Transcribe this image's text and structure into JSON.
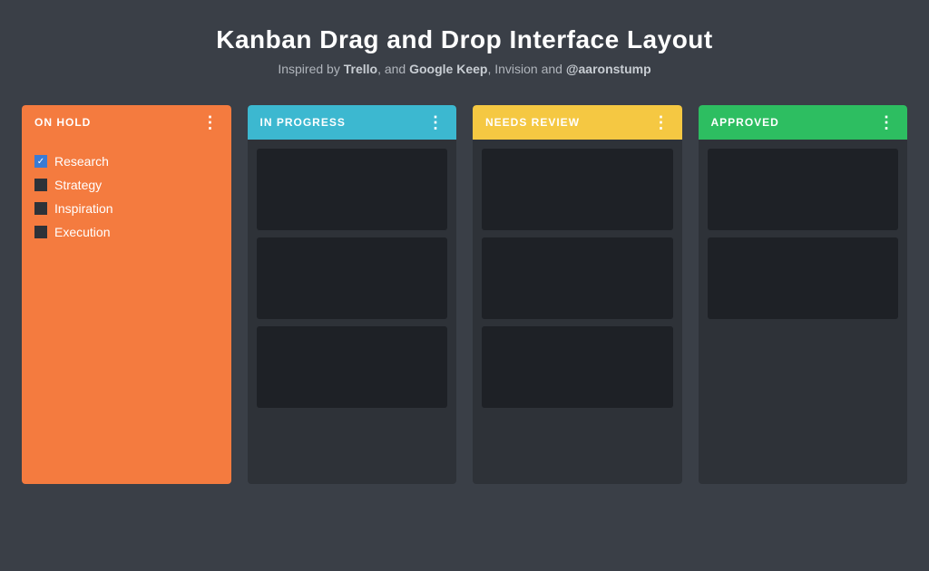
{
  "header": {
    "title": "Kanban Drag and Drop Interface Layout",
    "subtitle_prefix": "Inspired by ",
    "subtitle_items": [
      {
        "text": "Trello",
        "bold": true
      },
      {
        "text": ", and ",
        "bold": false
      },
      {
        "text": "Google Keep",
        "bold": true
      },
      {
        "text": ", Invision and ",
        "bold": false
      },
      {
        "text": "@aaronstump",
        "bold": true
      }
    ]
  },
  "columns": [
    {
      "id": "on-hold",
      "title": "ON HOLD",
      "color": "#f47b3f",
      "menu_icon": "⋮",
      "items": [
        {
          "label": "Research",
          "checked": true
        },
        {
          "label": "Strategy",
          "checked": false
        },
        {
          "label": "Inspiration",
          "checked": false
        },
        {
          "label": "Execution",
          "checked": false
        }
      ]
    },
    {
      "id": "in-progress",
      "title": "IN PROGRESS",
      "color": "#3cb8d0",
      "menu_icon": "⋮",
      "cards": 3
    },
    {
      "id": "needs-review",
      "title": "NEEDS REVIEW",
      "color": "#f5c842",
      "menu_icon": "⋮",
      "cards": 3
    },
    {
      "id": "approved",
      "title": "APPROVED",
      "color": "#2dbe61",
      "menu_icon": "⋮",
      "cards": 2
    }
  ]
}
